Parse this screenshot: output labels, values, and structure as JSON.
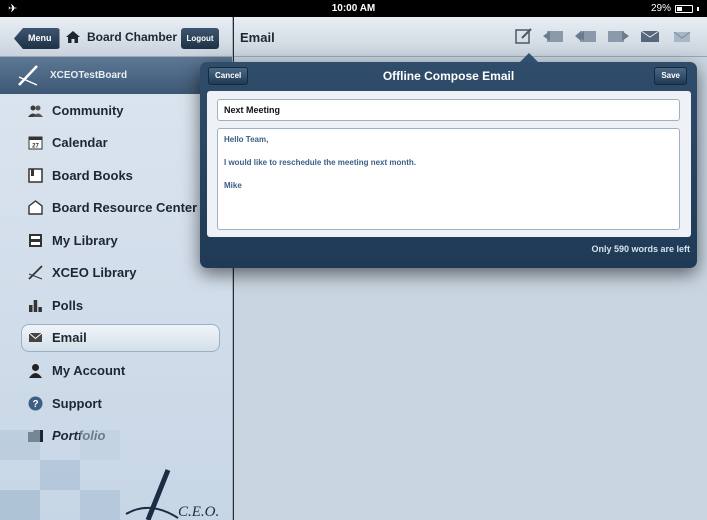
{
  "status_bar": {
    "left_icon": "airplane-icon",
    "time": "10:00 AM",
    "battery": "29%"
  },
  "sidebar": {
    "menu_button": "Menu",
    "title": "Board Chamber",
    "logout_button": "Logout",
    "board_name": "XCEOTestBoard",
    "items": [
      {
        "label": "Community",
        "icon": "community-icon"
      },
      {
        "label": "Calendar",
        "icon": "calendar-icon"
      },
      {
        "label": "Board Books",
        "icon": "book-icon"
      },
      {
        "label": "Board Resource Center",
        "icon": "resource-icon"
      },
      {
        "label": "My Library",
        "icon": "library-icon"
      },
      {
        "label": "XCEO Library",
        "icon": "xceo-icon"
      },
      {
        "label": "Polls",
        "icon": "polls-icon"
      },
      {
        "label": "Email",
        "icon": "email-icon"
      },
      {
        "label": "My Account",
        "icon": "account-icon"
      },
      {
        "label": "Support",
        "icon": "support-icon"
      },
      {
        "label": "Portfolio",
        "icon": "portfolio-icon"
      }
    ],
    "calendar_day": "27",
    "logo_text": "C.E.O."
  },
  "main": {
    "title": "Email"
  },
  "compose": {
    "cancel": "Cancel",
    "title": "Offline Compose Email",
    "save": "Save",
    "subject": "Next Meeting",
    "body": {
      "greeting": "Hello Team,",
      "line": "I would like to reschedule the meeting next month.",
      "signature": "Mike"
    },
    "words_left": "Only 590 words are left"
  },
  "colors": {
    "accent": "#2f4d6b",
    "text_blue": "#3b5f86"
  }
}
